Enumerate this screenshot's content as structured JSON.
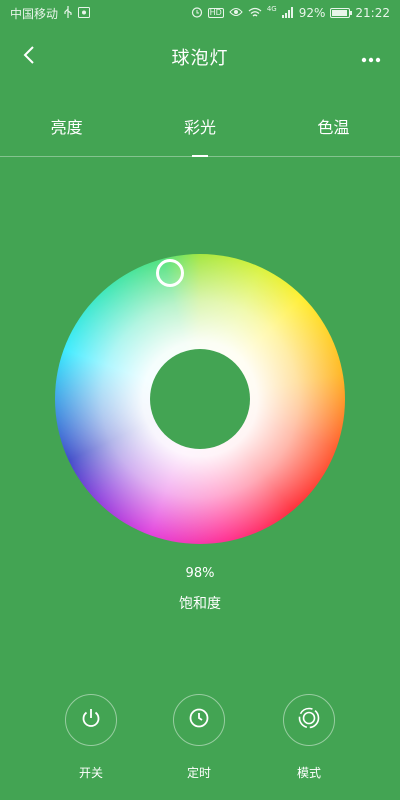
{
  "status_bar": {
    "carrier": "中国移动",
    "battery_percent": "92%",
    "battery_level": 0.92,
    "time": "21:22",
    "icons": [
      "usb-icon",
      "screenshot-icon",
      "alarm-icon",
      "hd-icon",
      "eye-icon",
      "wifi-icon",
      "signal-icon",
      "battery-icon"
    ],
    "hd_text": "HD",
    "network_text": "4G"
  },
  "nav": {
    "title": "球泡灯",
    "back_icon": "chevron-left-icon",
    "more_icon": "more-horizontal-icon"
  },
  "tabs": [
    {
      "label": "亮度",
      "active": false
    },
    {
      "label": "彩光",
      "active": true
    },
    {
      "label": "色温",
      "active": false
    }
  ],
  "color_wheel": {
    "saturation_value": "98%",
    "saturation_label": "饱和度"
  },
  "controls": [
    {
      "label": "开关",
      "icon": "power-icon"
    },
    {
      "label": "定时",
      "icon": "clock-icon"
    },
    {
      "label": "模式",
      "icon": "mode-icon"
    }
  ],
  "colors": {
    "background": "#43a453",
    "foreground": "#ffffff"
  }
}
